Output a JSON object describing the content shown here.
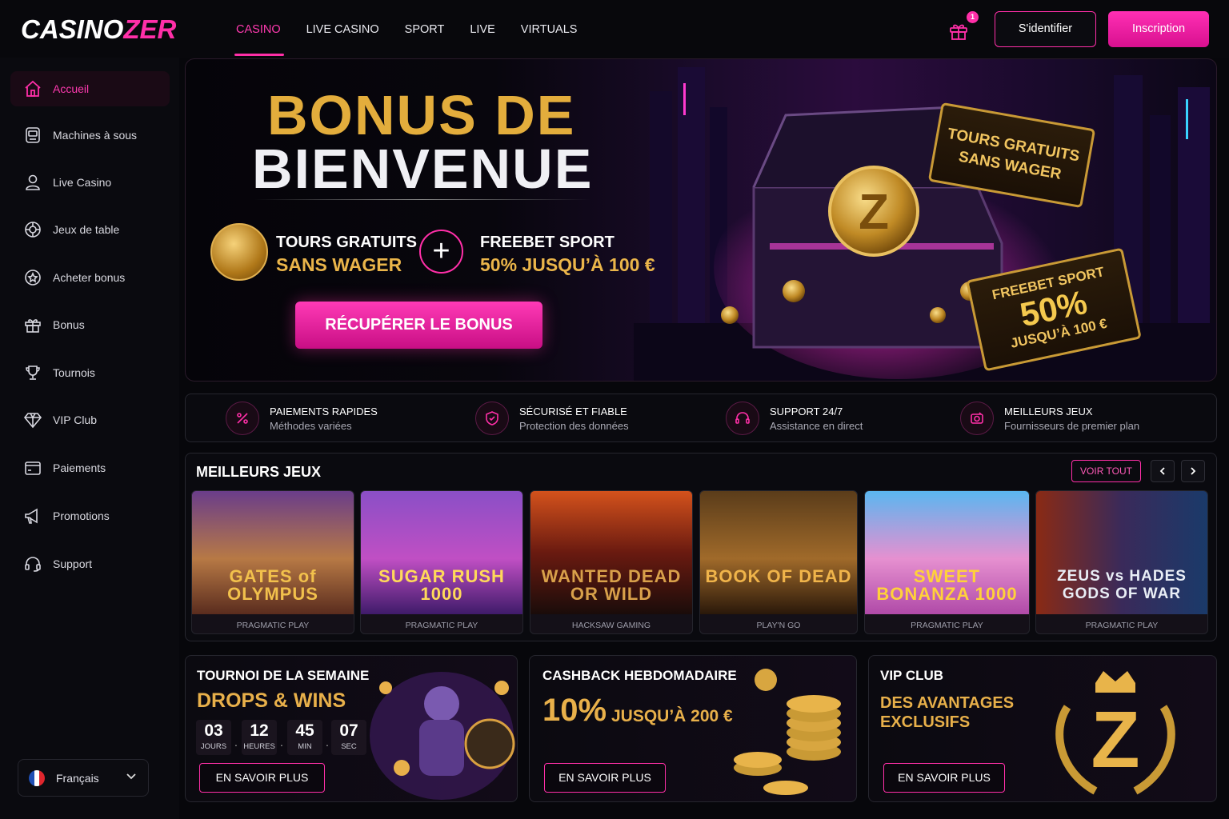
{
  "brand": {
    "part1": "CASINO",
    "part2": "ZER",
    "accent": "#ff2fa8",
    "gold": "#e3ad3c"
  },
  "nav": [
    {
      "label": "CASINO",
      "active": true
    },
    {
      "label": "LIVE CASINO"
    },
    {
      "label": "SPORT"
    },
    {
      "label": "LIVE"
    },
    {
      "label": "VIRTUALS"
    }
  ],
  "header": {
    "gift_icon": "gift-icon",
    "gift_badge": "1",
    "login_label": "S'identifier",
    "signup_label": "Inscription"
  },
  "sidebar": {
    "items": [
      {
        "label": "Accueil",
        "icon": "home-icon",
        "active": true
      },
      {
        "label": "Machines à sous",
        "icon": "slot-machine-icon"
      },
      {
        "label": "Live Casino",
        "icon": "dealer-icon"
      },
      {
        "label": "Jeux de table",
        "icon": "roulette-icon"
      },
      {
        "label": "Acheter bonus",
        "icon": "star-badge-icon"
      },
      {
        "label": "Bonus",
        "icon": "gift-icon"
      },
      {
        "label": "Tournois",
        "icon": "trophy-icon"
      },
      {
        "label": "VIP Club",
        "icon": "diamond-icon"
      },
      {
        "label": "Paiements",
        "icon": "wallet-icon"
      },
      {
        "label": "Promotions",
        "icon": "megaphone-icon"
      },
      {
        "label": "Support",
        "icon": "headset-icon"
      }
    ],
    "language": "Français"
  },
  "hero": {
    "title_line1": "BONUS DE",
    "title_line2": "BIENVENUE",
    "bonus1_line1": "TOURS GRATUITS",
    "bonus1_line2": "SANS WAGER",
    "bonus2_line1": "FREEBET SPORT",
    "bonus2_line2": "50% JUSQU’À 100 €",
    "cta": "RÉCUPÉRER LE BONUS",
    "ticket1_line1": "TOURS GRATUITS",
    "ticket1_line2": "SANS WAGER",
    "ticket2_line1": "FREEBET SPORT",
    "ticket2_line2": "50%",
    "ticket2_line3": "JUSQU’À 100 €"
  },
  "features": [
    {
      "title": "PAIEMENTS RAPIDES",
      "subtitle": "Méthodes variées",
      "icon": "fast-payment-icon"
    },
    {
      "title": "SÉCURISÉ ET FIABLE",
      "subtitle": "Protection des données",
      "icon": "shield-check-icon"
    },
    {
      "title": "SUPPORT 24/7",
      "subtitle": "Assistance en direct",
      "icon": "headset-icon"
    },
    {
      "title": "MEILLEURS JEUX",
      "subtitle": "Fournisseurs de premier plan",
      "icon": "star-card-icon"
    }
  ],
  "games": {
    "title": "MEILLEURS JEUX",
    "see_all": "VOIR TOUT",
    "items": [
      {
        "name": "GATES of OLYMPUS",
        "provider": "PRAGMATIC PLAY"
      },
      {
        "name": "SUGAR RUSH 1000",
        "provider": "PRAGMATIC PLAY"
      },
      {
        "name": "WANTED DEAD OR WILD",
        "provider": "HACKSAW GAMING"
      },
      {
        "name": "BOOK OF DEAD",
        "provider": "PLAY'N GO"
      },
      {
        "name": "SWEET BONANZA 1000",
        "provider": "PRAGMATIC PLAY"
      },
      {
        "name": "ZEUS vs HADES GODS OF WAR",
        "provider": "PRAGMATIC PLAY"
      }
    ]
  },
  "promos": {
    "tournament": {
      "title": "TOURNOI DE LA SEMAINE",
      "subtitle": "DROPS & WINS",
      "countdown": [
        {
          "value": "03",
          "unit": "JOURS"
        },
        {
          "value": "12",
          "unit": "HEURES"
        },
        {
          "value": "45",
          "unit": "MIN"
        },
        {
          "value": "07",
          "unit": "SEC"
        }
      ],
      "button": "EN SAVOIR PLUS"
    },
    "cashback": {
      "title": "CASHBACK HEBDOMADAIRE",
      "big": "10%",
      "rest": "JUSQU’À 200 €",
      "button": "EN SAVOIR PLUS"
    },
    "vip": {
      "title": "VIP CLUB",
      "line1": "DES AVANTAGES",
      "line2": "EXCLUSIFS",
      "button": "EN SAVOIR PLUS"
    }
  }
}
